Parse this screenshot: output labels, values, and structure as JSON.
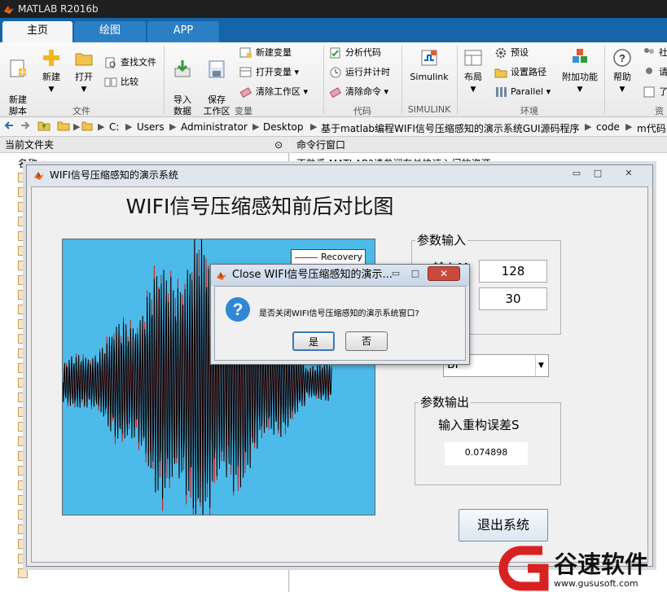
{
  "app": {
    "window_title": "MATLAB R2016b"
  },
  "tabs": [
    {
      "label": "主页",
      "active": true
    },
    {
      "label": "绘图",
      "active": false
    },
    {
      "label": "APP",
      "active": false
    }
  ],
  "ribbon": {
    "file": {
      "new_script": "新建\n脚本",
      "new": "新建",
      "open": "打开",
      "find_files": "查找文件",
      "compare": "比较",
      "group": "文件"
    },
    "variable": {
      "import": "导入\n数据",
      "save_ws": "保存\n工作区",
      "new_var": "新建变量",
      "open_var": "打开变量",
      "clear_ws": "清除工作区",
      "group": "变量"
    },
    "code": {
      "analyze": "分析代码",
      "run_time": "运行并计时",
      "clear_cmd": "清除命令",
      "group": "代码"
    },
    "simulink": {
      "label": "Simulink",
      "group": "SIMULINK"
    },
    "env": {
      "layout": "布局",
      "prefs": "预设",
      "set_path": "设置路径",
      "parallel": "Parallel",
      "addons": "附加功能",
      "group": "环境"
    },
    "resources": {
      "help": "帮助",
      "community": "社",
      "request": "请",
      "learn": "了",
      "group": "资"
    }
  },
  "address": {
    "segments": [
      "C:",
      "Users",
      "Administrator",
      "Desktop",
      "基于matlab编程WIFI信号压缩感知的演示系统GUI源码程序",
      "code",
      "m代码"
    ]
  },
  "left_pane": {
    "title": "当前文件夹",
    "column_name": "名称 ▲"
  },
  "right_pane": {
    "title": "命令行窗口",
    "notice": "不熟悉 MATLAB?请参阅有关快速入门的资源。"
  },
  "figure": {
    "title": "WIFI信号压缩感知的演示系统",
    "heading": "WIFI信号压缩感知前后对比图",
    "legend_label": "Recovery",
    "param_input_label": "参数输入",
    "input_m_label": "输入M",
    "input_m_value": "128",
    "input_k_value": "30",
    "method_value": "BP",
    "param_output_label": "参数输出",
    "output_desc": "输入重构误差S",
    "output_value": "0.074898",
    "exit_label": "退出系统"
  },
  "dialog": {
    "title": "Close WIFI信号压缩感知的演示...",
    "message": "是否关闭WIFI信号压缩感知的演示系统窗口?",
    "yes": "是",
    "no": "否"
  },
  "watermark": {
    "brand": "谷速软件",
    "url": "www.gususoft.com"
  },
  "colors": {
    "tabbar": "#1565a8",
    "plot_bg": "#4dbbe9",
    "signal": "#000000",
    "recovery": "#cc1a1a"
  }
}
